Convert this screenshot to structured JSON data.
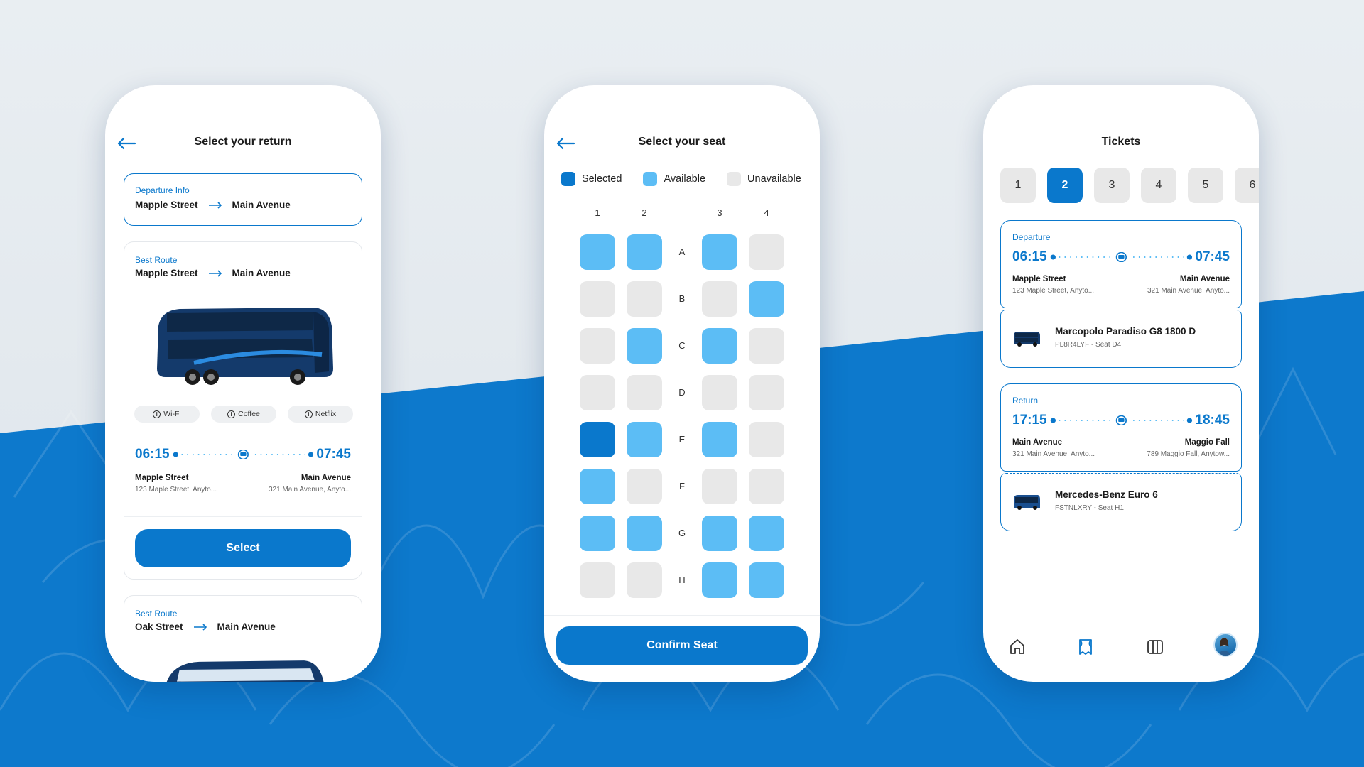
{
  "colors": {
    "primary": "#0a78cc",
    "available": "#5cbdf5",
    "unavailable": "#e8e8e8",
    "background_blue": "#0d79cc"
  },
  "screen_return": {
    "title": "Select your return",
    "departure_info": {
      "label": "Departure Info",
      "from": "Mapple Street",
      "to": "Main Avenue"
    },
    "route1": {
      "label": "Best Route",
      "from": "Mapple Street",
      "to": "Main Avenue",
      "amenities": [
        "Wi-Fi",
        "Coffee",
        "Netflix"
      ],
      "depart_time": "06:15",
      "arrive_time": "07:45",
      "origin_name": "Mapple Street",
      "origin_addr": "123 Maple Street, Anyto...",
      "dest_name": "Main Avenue",
      "dest_addr": "321 Main Avenue, Anyto...",
      "button": "Select"
    },
    "route2": {
      "label": "Best Route",
      "from": "Oak Street",
      "to": "Main Avenue"
    }
  },
  "screen_seat": {
    "title": "Select your seat",
    "legend": {
      "selected": "Selected",
      "available": "Available",
      "unavailable": "Unavailable"
    },
    "columns": [
      "1",
      "2",
      "3",
      "4"
    ],
    "rows": [
      {
        "label": "A",
        "seats": [
          "available",
          "available",
          "available",
          "unavailable"
        ]
      },
      {
        "label": "B",
        "seats": [
          "unavailable",
          "unavailable",
          "unavailable",
          "available"
        ]
      },
      {
        "label": "C",
        "seats": [
          "unavailable",
          "available",
          "available",
          "unavailable"
        ]
      },
      {
        "label": "D",
        "seats": [
          "unavailable",
          "unavailable",
          "unavailable",
          "unavailable"
        ]
      },
      {
        "label": "E",
        "seats": [
          "selected",
          "available",
          "available",
          "unavailable"
        ]
      },
      {
        "label": "F",
        "seats": [
          "available",
          "unavailable",
          "unavailable",
          "unavailable"
        ]
      },
      {
        "label": "G",
        "seats": [
          "available",
          "available",
          "available",
          "available"
        ]
      },
      {
        "label": "H",
        "seats": [
          "unavailable",
          "unavailable",
          "available",
          "available"
        ]
      }
    ],
    "button": "Confirm Seat"
  },
  "screen_tickets": {
    "title": "Tickets",
    "tabs": [
      "1",
      "2",
      "3",
      "4",
      "5",
      "6"
    ],
    "active_tab": "2",
    "departure": {
      "label": "Departure",
      "depart_time": "06:15",
      "arrive_time": "07:45",
      "origin_name": "Mapple Street",
      "origin_addr": "123 Maple Street, Anyto...",
      "dest_name": "Main Avenue",
      "dest_addr": "321 Main Avenue, Anyto...",
      "bus_name": "Marcopolo Paradiso G8 1800 D",
      "bus_info": "PL8R4LYF - Seat D4"
    },
    "return": {
      "label": "Return",
      "depart_time": "17:15",
      "arrive_time": "18:45",
      "origin_name": "Main Avenue",
      "origin_addr": "321 Main Avenue, Anyto...",
      "dest_name": "Maggio Fall",
      "dest_addr": "789 Maggio Fall, Anytow...",
      "bus_name": "Mercedes-Benz Euro 6",
      "bus_info": "FSTNLXRY - Seat H1"
    },
    "nav": [
      "home-icon",
      "ticket-icon",
      "map-icon",
      "profile-avatar"
    ]
  }
}
